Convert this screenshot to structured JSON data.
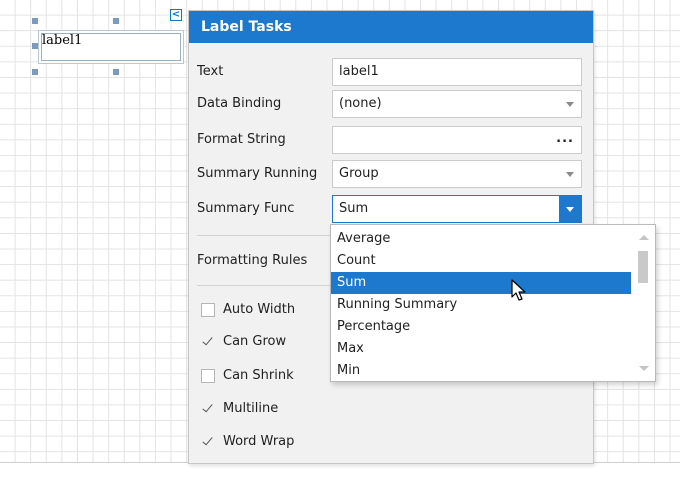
{
  "control": {
    "text": "label1"
  },
  "smart_tag": {
    "glyph": "<"
  },
  "panel": {
    "title": "Label Tasks",
    "rows": [
      {
        "label": "Text",
        "value": "label1",
        "kind": "text"
      },
      {
        "label": "Data Binding",
        "value": "(none)",
        "kind": "combo"
      },
      {
        "label": "Format String",
        "value": "",
        "kind": "ellipsis",
        "button": "..."
      },
      {
        "label": "Summary Running",
        "value": "Group",
        "kind": "combo"
      },
      {
        "label": "Summary Func",
        "value": "Sum",
        "kind": "combo-active"
      }
    ],
    "formatting_rules": {
      "label": "Formatting Rules"
    },
    "checkboxes": [
      {
        "label": "Auto Width",
        "checked": false
      },
      {
        "label": "Can Grow",
        "checked": true
      },
      {
        "label": "Can Shrink",
        "checked": false
      },
      {
        "label": "Multiline",
        "checked": true
      },
      {
        "label": "Word Wrap",
        "checked": true
      }
    ]
  },
  "dropdown": {
    "items": [
      "Average",
      "Count",
      "Sum",
      "Running Summary",
      "Percentage",
      "Max",
      "Min"
    ],
    "selected": "Sum"
  },
  "colors": {
    "accent": "#1c79cd",
    "grid": "#e3e3e3",
    "panel_bg": "#f1f1f1"
  }
}
